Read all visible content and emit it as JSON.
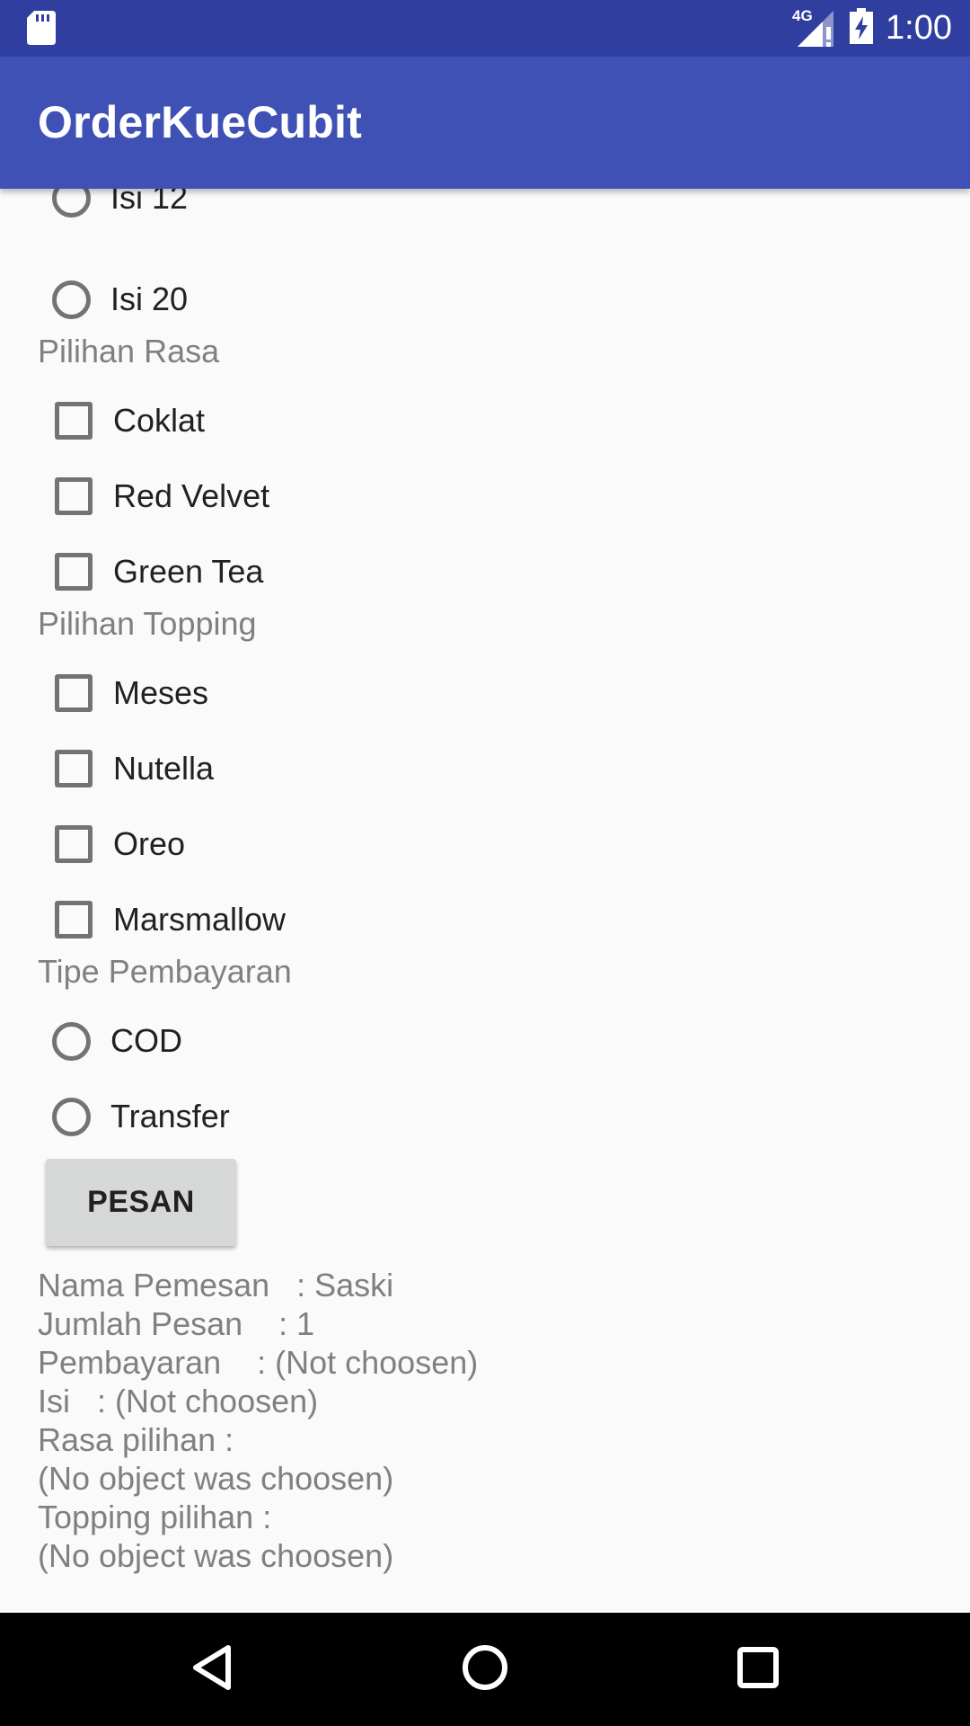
{
  "status_bar": {
    "time": "1:00",
    "network": "4G",
    "icons": [
      "sd-card-icon",
      "signal-icon",
      "battery-icon"
    ]
  },
  "app_bar": {
    "title": "OrderKueCubit"
  },
  "isi_options": [
    {
      "label": "Isi 12",
      "selected": false
    },
    {
      "label": "Isi 20",
      "selected": false
    }
  ],
  "rasa": {
    "label": "Pilihan Rasa",
    "options": [
      {
        "label": "Coklat",
        "checked": false
      },
      {
        "label": "Red Velvet",
        "checked": false
      },
      {
        "label": "Green Tea",
        "checked": false
      }
    ]
  },
  "topping": {
    "label": "Pilihan Topping",
    "options": [
      {
        "label": "Meses",
        "checked": false
      },
      {
        "label": "Nutella",
        "checked": false
      },
      {
        "label": "Oreo",
        "checked": false
      },
      {
        "label": "Marsmallow",
        "checked": false
      }
    ]
  },
  "pembayaran": {
    "label": "Tipe Pembayaran",
    "options": [
      {
        "label": "COD",
        "selected": false
      },
      {
        "label": "Transfer",
        "selected": false
      }
    ]
  },
  "order_button": {
    "label": "PESAN"
  },
  "summary": {
    "lines": [
      "Nama Pemesan   : Saski",
      "Jumlah Pesan    : 1",
      "Pembayaran    : (Not choosen)",
      "Isi   : (Not choosen)",
      "Rasa pilihan :",
      "(No object was choosen)",
      "Topping pilihan :",
      "(No object was choosen)"
    ]
  },
  "nav_bar": {
    "icons": [
      "back-icon",
      "home-icon",
      "recents-icon"
    ]
  },
  "colors": {
    "status_bar": "#303f9f",
    "app_bar": "#3f51b5",
    "background": "#fafafa",
    "control": "#737373",
    "secondary_text": "#808080",
    "button": "#d6d7d7"
  }
}
